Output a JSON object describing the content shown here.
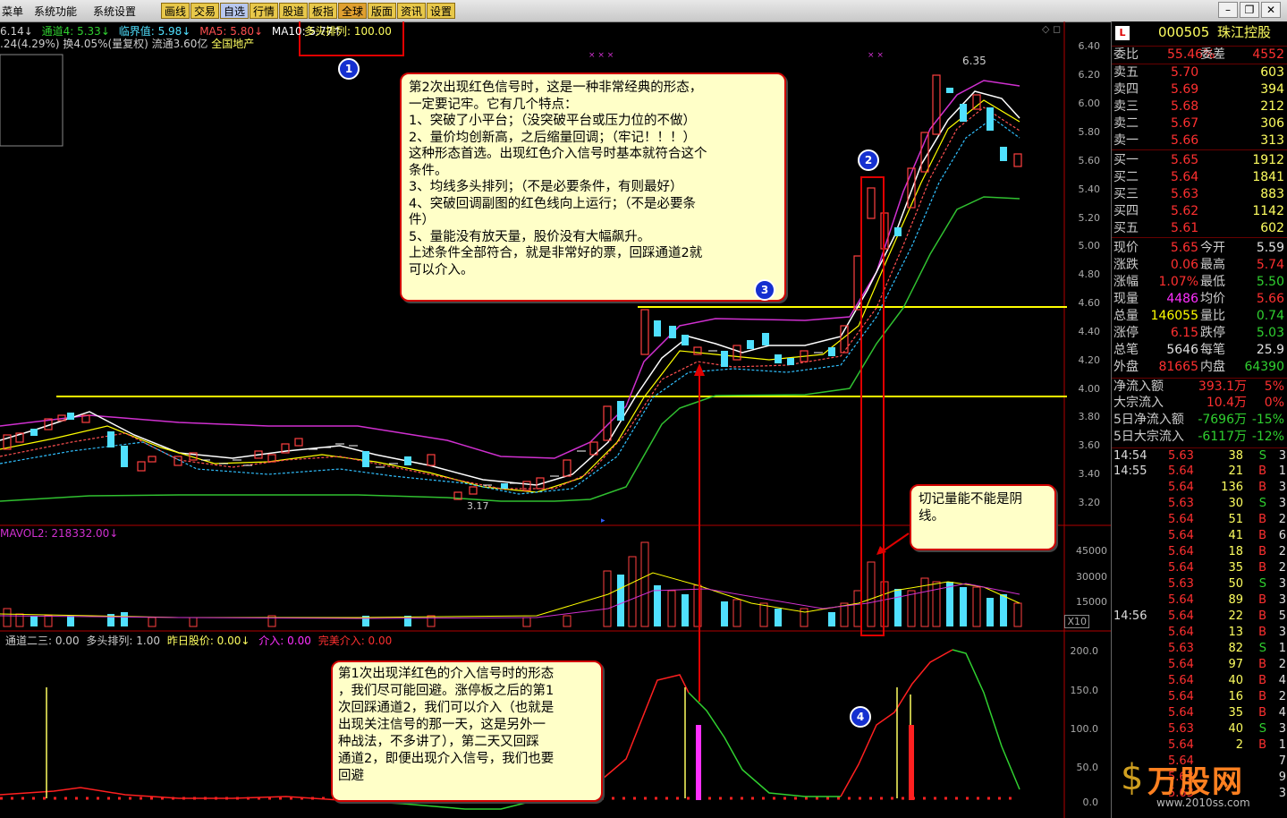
{
  "menu": {
    "items": [
      "菜单",
      "系统功能",
      "系统设置"
    ],
    "toolbar": [
      "画线",
      "交易",
      "自选",
      "行情",
      "股道",
      "板指",
      "全球",
      "版面",
      "资讯",
      "设置"
    ]
  },
  "indicators_top": {
    "line1_a": "6.14↓",
    "line1_b": "通道4: 5.33↓",
    "line1_c": "临界值: 5.98↓",
    "line1_d": "MA5: 5.80↓",
    "line1_e": "MA10: 5.77↑",
    "line1_f": "多头排列: 100.00",
    "line2": ".24(4.29%) 换4.05%(量复权) 流通3.60亿",
    "line2_sector": "全国地产"
  },
  "price_axis": [
    "6.40",
    "6.20",
    "6.00",
    "5.80",
    "5.60",
    "5.40",
    "5.20",
    "5.00",
    "4.80",
    "4.60",
    "4.40",
    "4.20",
    "4.00",
    "3.80",
    "3.60",
    "3.40",
    "3.20"
  ],
  "high_label": "6.35",
  "low_label": "3.17",
  "vol": {
    "label": "MAVOL2: 218332.00↓",
    "axis": [
      "45000",
      "30000",
      "15000",
      "X10"
    ]
  },
  "sub": {
    "label_a": "通道二三: 0.00",
    "label_b": "多头排列: 1.00",
    "label_c": "昨日股价: 0.00↓",
    "label_d": "介入: 0.00",
    "label_e": "完美介入: 0.00",
    "axis": [
      "200.0",
      "150.0",
      "100.0",
      "50.0",
      "0.0"
    ]
  },
  "callouts": {
    "main": "第2次出现红色信号时，这是一种非常经典的形态，\n一定要记牢。它有几个特点：\n1、突破了小平台；（没突破平台或压力位的不做）\n2、量价均创新高，之后缩量回调；（牢记！！！）\n这种形态首选。出现红色介入信号时基本就符合这个\n条件。\n3、均线多头排列；（不是必要条件，有则最好）\n4、突破回调副图的红色线向上运行；（不是必要条\n件）\n5、量能没有放天量，股价没有大幅飙升。\n上述条件全部符合，就是非常好的票，回踩通道2就\n可以介入。",
    "volume": "切记量能不能是阴\n线。",
    "first": "第1次出现洋红色的介入信号时的形态\n，我们尽可能回避。涨停板之后的第1\n次回踩通道2，我们可以介入（也就是\n出现关注信号的那一天，这是另外一\n种战法，不多讲了），第二天又回踩\n通道2，即便出现介入信号，我们也要\n回避"
  },
  "badges": [
    "1",
    "2",
    "3",
    "4"
  ],
  "panel": {
    "code": "000505",
    "name": "珠江控股",
    "webi_label": "委比",
    "webi": "55.46%",
    "weicha_label": "委差",
    "weicha": "4552",
    "asks": [
      {
        "label": "卖五",
        "price": "5.70",
        "vol": "603"
      },
      {
        "label": "卖四",
        "price": "5.69",
        "vol": "394"
      },
      {
        "label": "卖三",
        "price": "5.68",
        "vol": "212"
      },
      {
        "label": "卖二",
        "price": "5.67",
        "vol": "306"
      },
      {
        "label": "卖一",
        "price": "5.66",
        "vol": "313"
      }
    ],
    "bids": [
      {
        "label": "买一",
        "price": "5.65",
        "vol": "1912"
      },
      {
        "label": "买二",
        "price": "5.64",
        "vol": "1841"
      },
      {
        "label": "买三",
        "price": "5.63",
        "vol": "883"
      },
      {
        "label": "买四",
        "price": "5.62",
        "vol": "1142"
      },
      {
        "label": "买五",
        "price": "5.61",
        "vol": "602"
      }
    ],
    "stats": [
      {
        "l1": "现价",
        "v1": "5.65",
        "c1": "#ff3030",
        "l2": "今开",
        "v2": "5.59",
        "c2": "#e0e0e0"
      },
      {
        "l1": "涨跌",
        "v1": "0.06",
        "c1": "#ff3030",
        "l2": "最高",
        "v2": "5.74",
        "c2": "#ff3030"
      },
      {
        "l1": "涨幅",
        "v1": "1.07%",
        "c1": "#ff3030",
        "l2": "最低",
        "v2": "5.50",
        "c2": "#30d030"
      },
      {
        "l1": "现量",
        "v1": "4486",
        "c1": "#ff30ff",
        "l2": "均价",
        "v2": "5.66",
        "c2": "#ff3030"
      },
      {
        "l1": "总量",
        "v1": "146055",
        "c1": "#ffff00",
        "l2": "量比",
        "v2": "0.74",
        "c2": "#30d030"
      },
      {
        "l1": "涨停",
        "v1": "6.15",
        "c1": "#ff3030",
        "l2": "跌停",
        "v2": "5.03",
        "c2": "#30d030"
      },
      {
        "l1": "总笔",
        "v1": "5646",
        "c1": "#e0e0e0",
        "l2": "每笔",
        "v2": "25.9",
        "c2": "#e0e0e0"
      },
      {
        "l1": "外盘",
        "v1": "81665",
        "c1": "#ff3030",
        "l2": "内盘",
        "v2": "64390",
        "c2": "#30d030"
      }
    ],
    "flows": [
      {
        "label": "净流入额",
        "value": "393.1万",
        "pct": "5%",
        "c": "#ff3030"
      },
      {
        "label": "大宗流入",
        "value": "10.4万",
        "pct": "0%",
        "c": "#ff3030"
      },
      {
        "label": "5日净流入额",
        "value": "-7696万",
        "pct": "-15%",
        "c": "#30d030"
      },
      {
        "label": "5日大宗流入",
        "value": "-6117万",
        "pct": "-12%",
        "c": "#30d030"
      }
    ],
    "ticks": [
      {
        "t": "14:54",
        "p": "5.63",
        "v": "38",
        "s": "S",
        "n": "3"
      },
      {
        "t": "14:55",
        "p": "5.64",
        "v": "21",
        "s": "B",
        "n": "1"
      },
      {
        "t": "",
        "p": "5.64",
        "v": "136",
        "s": "B",
        "n": "3"
      },
      {
        "t": "",
        "p": "5.63",
        "v": "30",
        "s": "S",
        "n": "3"
      },
      {
        "t": "",
        "p": "5.64",
        "v": "51",
        "s": "B",
        "n": "2"
      },
      {
        "t": "",
        "p": "5.64",
        "v": "41",
        "s": "B",
        "n": "6"
      },
      {
        "t": "",
        "p": "5.64",
        "v": "18",
        "s": "B",
        "n": "2"
      },
      {
        "t": "",
        "p": "5.64",
        "v": "35",
        "s": "B",
        "n": "2"
      },
      {
        "t": "",
        "p": "5.63",
        "v": "50",
        "s": "S",
        "n": "3"
      },
      {
        "t": "",
        "p": "5.64",
        "v": "89",
        "s": "B",
        "n": "3"
      },
      {
        "t": "14:56",
        "p": "5.64",
        "v": "22",
        "s": "B",
        "n": "5"
      },
      {
        "t": "",
        "p": "5.64",
        "v": "13",
        "s": "B",
        "n": "3"
      },
      {
        "t": "",
        "p": "5.63",
        "v": "82",
        "s": "S",
        "n": "1"
      },
      {
        "t": "",
        "p": "5.64",
        "v": "97",
        "s": "B",
        "n": "2"
      },
      {
        "t": "",
        "p": "5.64",
        "v": "40",
        "s": "B",
        "n": "4"
      },
      {
        "t": "",
        "p": "5.64",
        "v": "16",
        "s": "B",
        "n": "2"
      },
      {
        "t": "",
        "p": "5.64",
        "v": "35",
        "s": "B",
        "n": "4"
      },
      {
        "t": "",
        "p": "5.63",
        "v": "40",
        "s": "S",
        "n": "3"
      },
      {
        "t": "",
        "p": "5.64",
        "v": "2",
        "s": "B",
        "n": "1"
      },
      {
        "t": "",
        "p": "5.64",
        "v": "",
        "s": "",
        "n": "7"
      },
      {
        "t": "",
        "p": "5.63",
        "v": "",
        "s": "",
        "n": "9"
      },
      {
        "t": "",
        "p": "5.63",
        "v": "",
        "s": "",
        "n": "3"
      }
    ],
    "watermark": "万股网",
    "watermark_url": "www.2010ss.com"
  }
}
